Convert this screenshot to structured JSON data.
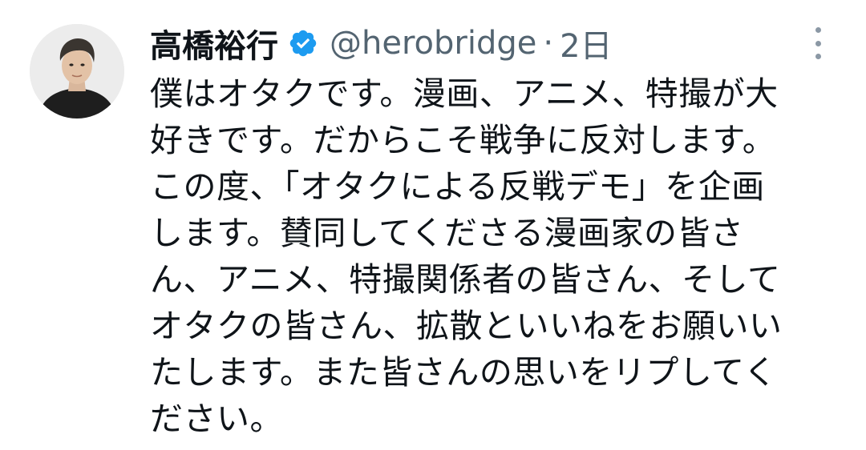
{
  "tweet": {
    "author": {
      "display_name": "高橋裕行",
      "handle": "@herobridge",
      "verified": true,
      "avatar": "profile-photo"
    },
    "separator": "·",
    "timestamp": "2日",
    "lines": [
      "僕はオタクです。漫画、アニメ、特撮が大",
      "好きです。だからこそ戦争に反対します。",
      "この度、「オタクによる反戦デモ」を企画",
      "します。賛同してくださる漫画家の皆さ",
      "ん、アニメ、特撮関係者の皆さん、そして",
      "オタクの皆さん、拡散といいねをお願いい",
      "たします。また皆さんの思いをリプしてく",
      "ださい。"
    ],
    "icons": {
      "verified": "verified-badge-icon",
      "more": "more-vertical-icon"
    },
    "colors": {
      "text": "#0f1419",
      "secondary": "#536471",
      "verified": "#1d9bf0",
      "background": "#ffffff"
    }
  }
}
